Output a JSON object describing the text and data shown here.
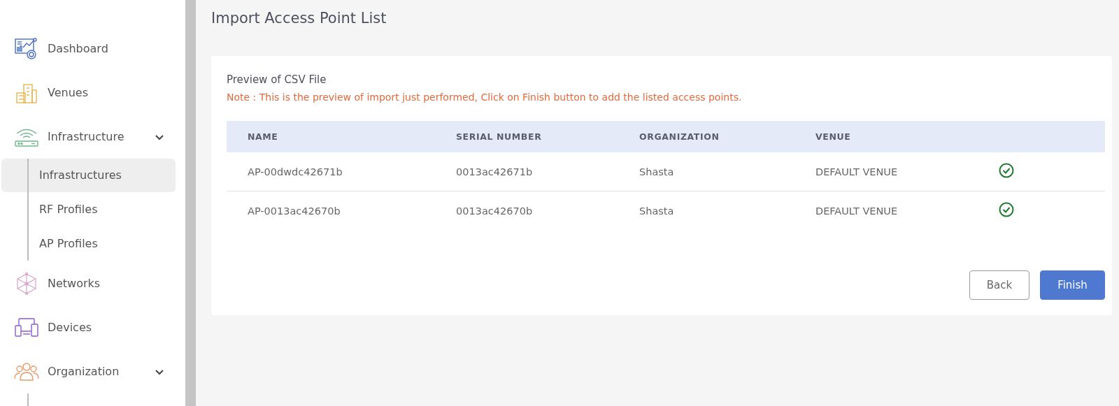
{
  "sidebar": {
    "items": [
      {
        "label": "Dashboard"
      },
      {
        "label": "Venues"
      },
      {
        "label": "Infrastructure",
        "expanded": true,
        "children": [
          {
            "label": "Infrastructures",
            "selected": true
          },
          {
            "label": "RF Profiles",
            "selected": false
          },
          {
            "label": "AP Profiles",
            "selected": false
          }
        ]
      },
      {
        "label": "Networks"
      },
      {
        "label": "Devices"
      },
      {
        "label": "Organization",
        "expanded": true
      }
    ]
  },
  "page": {
    "title": "Import Access Point List"
  },
  "card": {
    "title": "Preview of CSV File",
    "note": "Note : This is the preview of import just performed, Click on Finish button to add the listed access points."
  },
  "table": {
    "columns": [
      "NAME",
      "SERIAL NUMBER",
      "ORGANIZATION",
      "VENUE"
    ],
    "rows": [
      {
        "cells": [
          "AP-00dwdc42671b",
          "0013ac42671b",
          "Shasta",
          "DEFAULT VENUE"
        ],
        "valid": true
      },
      {
        "cells": [
          "AP-0013ac42670b",
          "0013ac42670b",
          "Shasta",
          "DEFAULT VENUE"
        ],
        "valid": true
      }
    ]
  },
  "buttons": [
    {
      "label": "Back",
      "kind": "secondary"
    },
    {
      "label": "Finish",
      "kind": "primary"
    }
  ]
}
